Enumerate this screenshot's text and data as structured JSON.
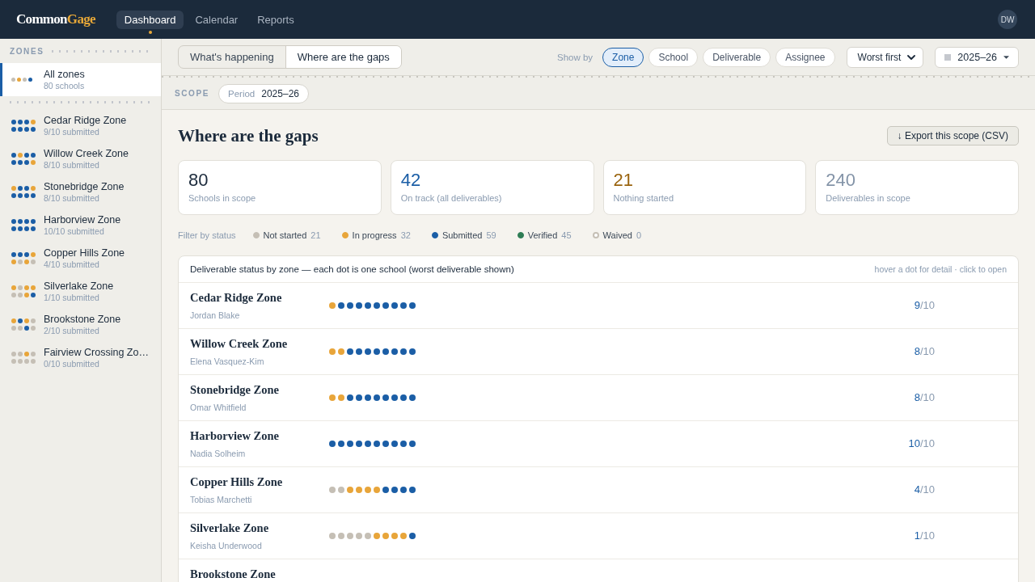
{
  "top_bar": {
    "logo": {
      "text": "Common",
      "accent": "Gage"
    },
    "nav": [
      {
        "label": "Dashboard",
        "selected": true
      },
      {
        "label": "Calendar",
        "selected": false
      },
      {
        "label": "Reports",
        "selected": false
      }
    ],
    "avatar": "DW"
  },
  "sidebar": {
    "heading": "ZONES",
    "all_zones": {
      "name": "All zones",
      "subtitle": "80 schools",
      "selected": true,
      "dots": [
        {
          "color": "#c5bfb5"
        },
        {
          "color": "#e8a53a"
        },
        {
          "color": "#c5bfb5"
        },
        {
          "color": "#1b5ea6"
        }
      ]
    },
    "zones": [
      {
        "name": "Cedar Ridge Zone",
        "subtitle": "9/10 submitted",
        "selected": false,
        "dots": [
          {
            "color": "#1b5ea6"
          },
          {
            "color": "#1b5ea6"
          },
          {
            "color": "#1b5ea6"
          },
          {
            "color": "#e8a53a"
          },
          {
            "color": "#1b5ea6"
          },
          {
            "color": "#1b5ea6"
          },
          {
            "color": "#1b5ea6"
          },
          {
            "color": "#1b5ea6"
          }
        ]
      },
      {
        "name": "Willow Creek Zone",
        "subtitle": "8/10 submitted",
        "selected": false,
        "dots": [
          {
            "color": "#1b5ea6"
          },
          {
            "color": "#e8a53a"
          },
          {
            "color": "#1b5ea6"
          },
          {
            "color": "#1b5ea6"
          },
          {
            "color": "#1b5ea6"
          },
          {
            "color": "#1b5ea6"
          },
          {
            "color": "#1b5ea6"
          },
          {
            "color": "#e8a53a"
          }
        ]
      },
      {
        "name": "Stonebridge Zone",
        "subtitle": "8/10 submitted",
        "selected": false,
        "dots": [
          {
            "color": "#e8a53a"
          },
          {
            "color": "#1b5ea6"
          },
          {
            "color": "#1b5ea6"
          },
          {
            "color": "#e8a53a"
          },
          {
            "color": "#1b5ea6"
          },
          {
            "color": "#1b5ea6"
          },
          {
            "color": "#1b5ea6"
          },
          {
            "color": "#1b5ea6"
          }
        ]
      },
      {
        "name": "Harborview Zone",
        "subtitle": "10/10 submitted",
        "selected": false,
        "dots": [
          {
            "color": "#1b5ea6"
          },
          {
            "color": "#1b5ea6"
          },
          {
            "color": "#1b5ea6"
          },
          {
            "color": "#1b5ea6"
          },
          {
            "color": "#1b5ea6"
          },
          {
            "color": "#1b5ea6"
          },
          {
            "color": "#1b5ea6"
          },
          {
            "color": "#1b5ea6"
          }
        ]
      },
      {
        "name": "Copper Hills Zone",
        "subtitle": "4/10 submitted",
        "selected": false,
        "dots": [
          {
            "color": "#1b5ea6"
          },
          {
            "color": "#1b5ea6"
          },
          {
            "color": "#1b5ea6"
          },
          {
            "color": "#e8a53a"
          },
          {
            "color": "#e8a53a"
          },
          {
            "color": "#c5bfb5"
          },
          {
            "color": "#e8a53a"
          },
          {
            "color": "#c5bfb5"
          }
        ]
      },
      {
        "name": "Silverlake Zone",
        "subtitle": "1/10 submitted",
        "selected": false,
        "dots": [
          {
            "color": "#e8a53a"
          },
          {
            "color": "#c5bfb5"
          },
          {
            "color": "#e8a53a"
          },
          {
            "color": "#e8a53a"
          },
          {
            "color": "#c5bfb5"
          },
          {
            "color": "#c5bfb5"
          },
          {
            "color": "#e8a53a"
          },
          {
            "color": "#1b5ea6"
          }
        ]
      },
      {
        "name": "Brookstone Zone",
        "subtitle": "2/10 submitted",
        "selected": false,
        "dots": [
          {
            "color": "#e8a53a"
          },
          {
            "color": "#1b5ea6"
          },
          {
            "color": "#e8a53a"
          },
          {
            "color": "#c5bfb5"
          },
          {
            "color": "#c5bfb5"
          },
          {
            "color": "#c5bfb5"
          },
          {
            "color": "#1b5ea6"
          },
          {
            "color": "#c5bfb5"
          }
        ]
      },
      {
        "name": "Fairview Crossing Zo…",
        "subtitle": "0/10 submitted",
        "selected": false,
        "dots": [
          {
            "color": "#c5bfb5"
          },
          {
            "color": "#c5bfb5"
          },
          {
            "color": "#e8a53a"
          },
          {
            "color": "#c5bfb5"
          },
          {
            "color": "#c5bfb5"
          },
          {
            "color": "#c5bfb5"
          },
          {
            "color": "#c5bfb5"
          },
          {
            "color": "#c5bfb5"
          }
        ]
      }
    ]
  },
  "toolbar": {
    "views": [
      {
        "label": "What's happening",
        "selected": false
      },
      {
        "label": "Where are the gaps",
        "selected": true
      }
    ],
    "show_by": {
      "label": "Show by",
      "options": [
        {
          "label": "Zone",
          "selected": true
        },
        {
          "label": "School",
          "selected": false
        },
        {
          "label": "Deliverable",
          "selected": false
        },
        {
          "label": "Assignee",
          "selected": false
        }
      ]
    },
    "sort": {
      "value": "Worst first"
    },
    "period": {
      "value": "2025–26"
    }
  },
  "scope": {
    "label": "SCOPE",
    "chips": [
      {
        "key": "Period",
        "value": "2025–26"
      }
    ]
  },
  "page": {
    "title": "Where are the gaps",
    "export_button": "↓ Export this scope (CSV)"
  },
  "stats": [
    {
      "value": "80",
      "label": "Schools in scope",
      "color": "#1b2a3b"
    },
    {
      "value": "42",
      "label": "On track (all deliverables)",
      "color": "#1b5ea6"
    },
    {
      "value": "21",
      "label": "Nothing started",
      "color": "#9a640f"
    },
    {
      "value": "240",
      "label": "Deliverables in scope",
      "color": "#8494a8"
    }
  ],
  "status_filter": {
    "label": "Filter by status",
    "items": [
      {
        "label": "Not started",
        "count": "21",
        "color": "#c5bfb5",
        "hollow": false
      },
      {
        "label": "In progress",
        "count": "32",
        "color": "#e8a53a",
        "hollow": false
      },
      {
        "label": "Submitted",
        "count": "59",
        "color": "#1b5ea6",
        "hollow": false
      },
      {
        "label": "Verified",
        "count": "45",
        "color": "#2e7d55",
        "hollow": false
      },
      {
        "label": "Waived",
        "count": "0",
        "color": "#c5bfb5",
        "hollow": true
      }
    ]
  },
  "table": {
    "caption": "Deliverable status by zone — each dot is one school (worst deliverable shown)",
    "hint": "hover a dot for detail · click to open",
    "rows": [
      {
        "name": "Cedar Ridge Zone",
        "lead": "Jordan Blake",
        "submitted": "9",
        "total": "/10",
        "dots": [
          {
            "color": "#e8a53a"
          },
          {
            "color": "#1b5ea6"
          },
          {
            "color": "#1b5ea6"
          },
          {
            "color": "#1b5ea6"
          },
          {
            "color": "#1b5ea6"
          },
          {
            "color": "#1b5ea6"
          },
          {
            "color": "#1b5ea6"
          },
          {
            "color": "#1b5ea6"
          },
          {
            "color": "#1b5ea6"
          },
          {
            "color": "#1b5ea6"
          }
        ]
      },
      {
        "name": "Willow Creek Zone",
        "lead": "Elena Vasquez-Kim",
        "submitted": "8",
        "total": "/10",
        "dots": [
          {
            "color": "#e8a53a"
          },
          {
            "color": "#e8a53a"
          },
          {
            "color": "#1b5ea6"
          },
          {
            "color": "#1b5ea6"
          },
          {
            "color": "#1b5ea6"
          },
          {
            "color": "#1b5ea6"
          },
          {
            "color": "#1b5ea6"
          },
          {
            "color": "#1b5ea6"
          },
          {
            "color": "#1b5ea6"
          },
          {
            "color": "#1b5ea6"
          }
        ]
      },
      {
        "name": "Stonebridge Zone",
        "lead": "Omar Whitfield",
        "submitted": "8",
        "total": "/10",
        "dots": [
          {
            "color": "#e8a53a"
          },
          {
            "color": "#e8a53a"
          },
          {
            "color": "#1b5ea6"
          },
          {
            "color": "#1b5ea6"
          },
          {
            "color": "#1b5ea6"
          },
          {
            "color": "#1b5ea6"
          },
          {
            "color": "#1b5ea6"
          },
          {
            "color": "#1b5ea6"
          },
          {
            "color": "#1b5ea6"
          },
          {
            "color": "#1b5ea6"
          }
        ]
      },
      {
        "name": "Harborview Zone",
        "lead": "Nadia Solheim",
        "submitted": "10",
        "total": "/10",
        "dots": [
          {
            "color": "#1b5ea6"
          },
          {
            "color": "#1b5ea6"
          },
          {
            "color": "#1b5ea6"
          },
          {
            "color": "#1b5ea6"
          },
          {
            "color": "#1b5ea6"
          },
          {
            "color": "#1b5ea6"
          },
          {
            "color": "#1b5ea6"
          },
          {
            "color": "#1b5ea6"
          },
          {
            "color": "#1b5ea6"
          },
          {
            "color": "#1b5ea6"
          }
        ]
      },
      {
        "name": "Copper Hills Zone",
        "lead": "Tobias Marchetti",
        "submitted": "4",
        "total": "/10",
        "dots": [
          {
            "color": "#c5bfb5"
          },
          {
            "color": "#c5bfb5"
          },
          {
            "color": "#e8a53a"
          },
          {
            "color": "#e8a53a"
          },
          {
            "color": "#e8a53a"
          },
          {
            "color": "#e8a53a"
          },
          {
            "color": "#1b5ea6"
          },
          {
            "color": "#1b5ea6"
          },
          {
            "color": "#1b5ea6"
          },
          {
            "color": "#1b5ea6"
          }
        ]
      },
      {
        "name": "Silverlake Zone",
        "lead": "Keisha Underwood",
        "submitted": "1",
        "total": "/10",
        "dots": [
          {
            "color": "#c5bfb5"
          },
          {
            "color": "#c5bfb5"
          },
          {
            "color": "#c5bfb5"
          },
          {
            "color": "#c5bfb5"
          },
          {
            "color": "#c5bfb5"
          },
          {
            "color": "#e8a53a"
          },
          {
            "color": "#e8a53a"
          },
          {
            "color": "#e8a53a"
          },
          {
            "color": "#e8a53a"
          },
          {
            "color": "#1b5ea6"
          }
        ]
      },
      {
        "name": "Brookstone Zone"
      }
    ]
  }
}
